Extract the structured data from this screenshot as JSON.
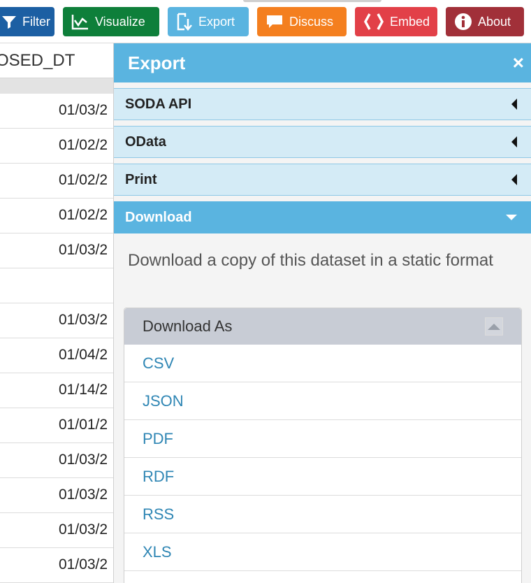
{
  "toolbar": {
    "buttons": [
      {
        "label": "Filter",
        "icon": "filter-icon"
      },
      {
        "label": "Visualize",
        "icon": "chart-icon"
      },
      {
        "label": "Export",
        "icon": "export-icon"
      },
      {
        "label": "Discuss",
        "icon": "speech-bubble-icon"
      },
      {
        "label": "Embed",
        "icon": "code-brackets-icon"
      },
      {
        "label": "About",
        "icon": "info-icon"
      }
    ],
    "colors": {
      "filter": "#1c5fa3",
      "visualize": "#0e7f3a",
      "export": "#5ab4e0",
      "discuss": "#f47f1f",
      "embed": "#e24048",
      "about": "#a13039"
    }
  },
  "grid": {
    "column_header": "OSED_DT",
    "rows": [
      "01/03/2",
      "01/02/2",
      "01/02/2",
      "01/02/2",
      "01/03/2",
      "",
      "01/03/2",
      "01/04/2",
      "01/14/2",
      "01/01/2",
      "01/03/2",
      "01/03/2",
      "01/03/2",
      "01/03/2"
    ]
  },
  "panel": {
    "title": "Export",
    "close_icon": "close-icon",
    "sections": [
      {
        "label": "SODA API",
        "state": "collapsed"
      },
      {
        "label": "OData",
        "state": "collapsed"
      },
      {
        "label": "Print",
        "state": "collapsed"
      },
      {
        "label": "Download",
        "state": "expanded"
      }
    ],
    "download": {
      "description": "Download a copy of this dataset in a static format",
      "list_header": "Download As",
      "formats": [
        "CSV",
        "JSON",
        "PDF",
        "RDF",
        "RSS",
        "XLS"
      ]
    }
  }
}
